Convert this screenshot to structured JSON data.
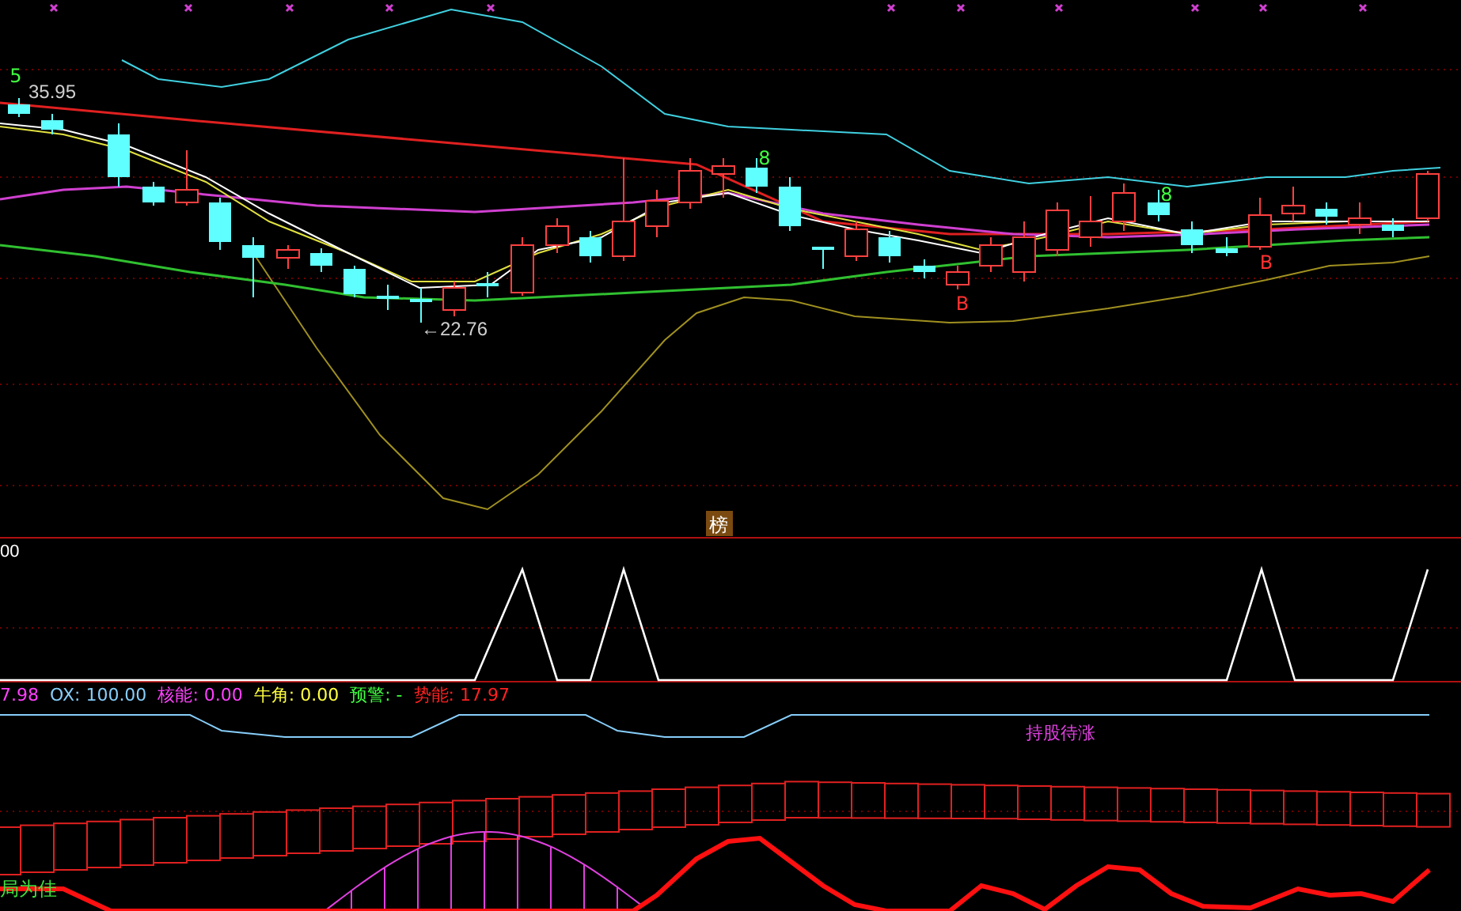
{
  "main_panel": {
    "high_label": "35.95",
    "low_label": "←22.76",
    "tag": "榜"
  },
  "markers": [
    {
      "kind": "sell",
      "label": "5"
    },
    {
      "kind": "sell",
      "label": "8"
    },
    {
      "kind": "sell",
      "label": "8"
    },
    {
      "kind": "buy",
      "label": "B"
    },
    {
      "kind": "buy",
      "label": "B"
    }
  ],
  "oscillator_panel": {
    "label": "00"
  },
  "indicator_panel": {
    "readouts": [
      {
        "label": "7.98",
        "color": "#ff40ff"
      },
      {
        "label": "OX: 100.00",
        "color": "#87cefa"
      },
      {
        "label": "核能: 0.00",
        "color": "#ff40ff"
      },
      {
        "label": "牛角: 0.00",
        "color": "#ffff40"
      },
      {
        "label": "预警: -",
        "color": "#40ff40"
      },
      {
        "label": "势能: 17.97",
        "color": "#ff2020"
      }
    ],
    "status": "持股待涨",
    "hint": "局为佳"
  }
}
